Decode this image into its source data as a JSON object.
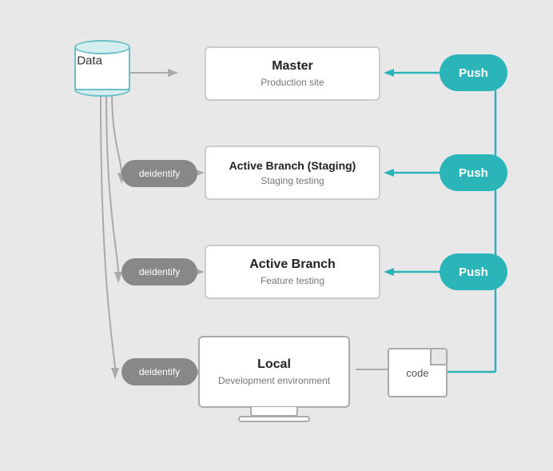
{
  "diagram": {
    "data_label": "Data",
    "boxes": [
      {
        "id": "master",
        "title": "Master",
        "subtitle": "Production site"
      },
      {
        "id": "staging",
        "title": "Active Branch (Staging)",
        "subtitle": "Staging testing"
      },
      {
        "id": "feature",
        "title": "Active Branch",
        "subtitle": "Feature testing"
      },
      {
        "id": "local",
        "title": "Local",
        "subtitle": "Development environment"
      }
    ],
    "push_label": "Push",
    "deidentify_label": "deidentify",
    "code_label": "code",
    "colors": {
      "teal": "#2bb5b8",
      "cylinder_stroke": "#6bbfc5",
      "pill_bg": "#888888",
      "box_border": "#cccccc",
      "arrow": "#999999",
      "line_teal": "#2bb5b8"
    }
  }
}
